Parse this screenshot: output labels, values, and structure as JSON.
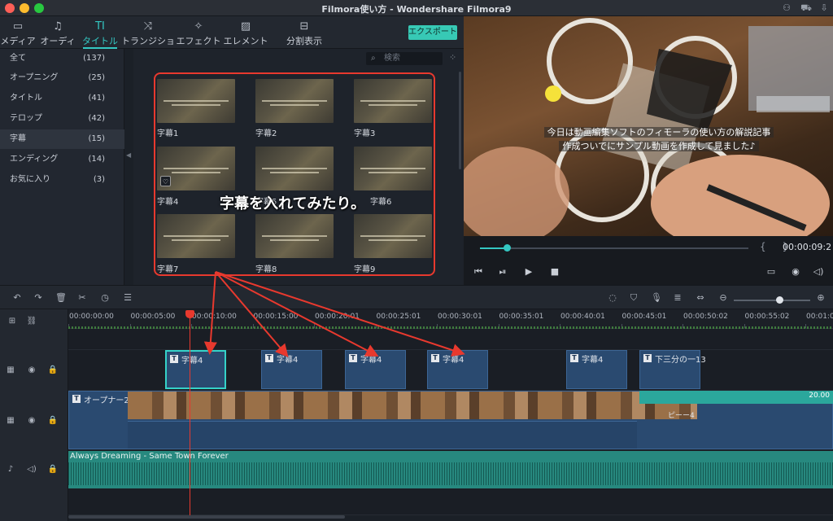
{
  "window": {
    "title": "Filmora使い方 - Wondershare Filmora9"
  },
  "toolbar": {
    "tabs": [
      {
        "label": "メディア",
        "icon": "folder-icon"
      },
      {
        "label": "オーディオ",
        "icon": "music-note-icon"
      },
      {
        "label": "タイトル",
        "icon": "title-icon"
      },
      {
        "label": "トランジション",
        "icon": "transition-icon"
      },
      {
        "label": "エフェクト",
        "icon": "effects-icon"
      },
      {
        "label": "エレメント",
        "icon": "image-icon"
      },
      {
        "label": "分割表示",
        "icon": "split-screen-icon"
      }
    ],
    "active_tab": "タイトル",
    "export_label": "エクスポート"
  },
  "categories": [
    {
      "label": "全て",
      "count": "(137)"
    },
    {
      "label": "オープニング",
      "count": "(25)"
    },
    {
      "label": "タイトル",
      "count": "(41)"
    },
    {
      "label": "テロップ",
      "count": "(42)"
    },
    {
      "label": "字幕",
      "count": "(15)"
    },
    {
      "label": "エンディング",
      "count": "(14)"
    },
    {
      "label": "お気に入り",
      "count": "(3)"
    }
  ],
  "selected_category": "字幕",
  "search": {
    "placeholder": "検索"
  },
  "library": {
    "items": [
      {
        "label": "字幕1"
      },
      {
        "label": "字幕2"
      },
      {
        "label": "字幕3"
      },
      {
        "label": "字幕4"
      },
      {
        "label": "字幕5"
      },
      {
        "label": "字幕6"
      },
      {
        "label": "字幕7"
      },
      {
        "label": "字幕8"
      },
      {
        "label": "字幕9"
      }
    ],
    "annotation": "字幕を入れてみたり。",
    "annotation_color": "#e8392e"
  },
  "preview": {
    "subtitle_line1": "今日は動画編集ソフトのフィモーラの使い方の解説記事",
    "subtitle_line2": "作成ついでにサンプル動画を作成して見ました♪",
    "timecode": "00:00:09:2",
    "progress_fraction": 0.1
  },
  "timeline": {
    "ruler": [
      "00:00:00:00",
      "00:00:05:00",
      "00:00:10:00",
      "00:00:15:00",
      "00:00:20:01",
      "00:00:25:01",
      "00:00:30:01",
      "00:00:35:01",
      "00:00:40:01",
      "00:00:45:01",
      "00:00:50:02",
      "00:00:55:02",
      "00:01:00"
    ],
    "title_clips": [
      "字幕4",
      "字幕4",
      "字幕4",
      "字幕4",
      "字幕4",
      "下三分の一13"
    ],
    "video_clip_label": "オープナー2",
    "video_clip_secondary": "ピーー4",
    "teal_clip_label": "20.00",
    "audio_label": "Always Dreaming - Same Town Forever",
    "zoom_level": 0.6,
    "accent_color": "#34c7c2"
  }
}
